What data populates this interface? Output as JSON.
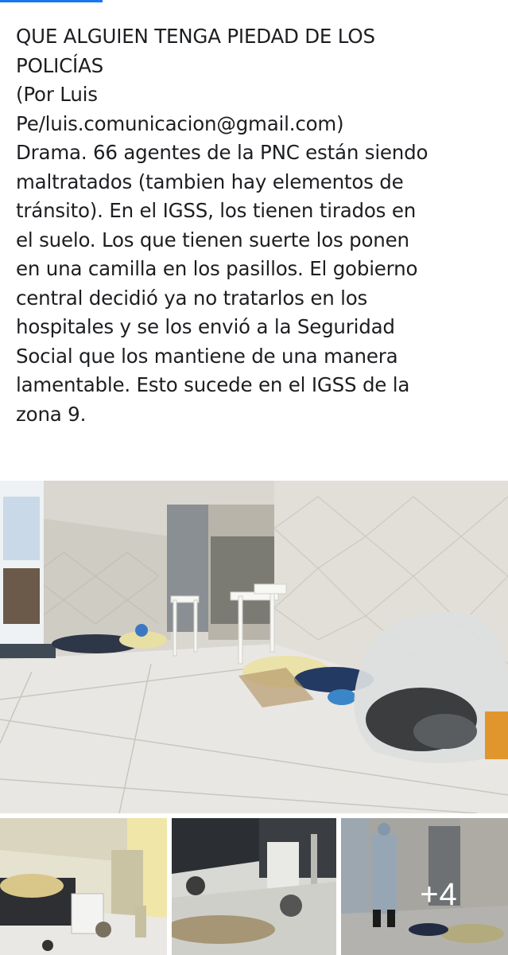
{
  "post": {
    "lines": [
      "QUE ALGUIEN TENGA PIEDAD DE LOS",
      "POLICÍAS",
      "(Por Luis",
      "Pe/luis.comunicacion@gmail.com)",
      "Drama. 66 agentes de la PNC están siendo",
      "maltratados (tambien hay elementos de",
      "tránsito). En el IGSS, los tienen tirados en",
      "el suelo. Los que tienen suerte los ponen",
      "en una camilla en los pasillos. El gobierno",
      "central decidió ya no tratarlos en los",
      "hospitales y se los envió a la Seguridad",
      "Social que los mantiene de una manera",
      "lamentable. Esto sucede en el IGSS de la",
      "zona 9."
    ]
  },
  "gallery": {
    "more_count": "+4"
  },
  "colors": {
    "accent": "#1877f2",
    "text": "#1c1e21"
  }
}
